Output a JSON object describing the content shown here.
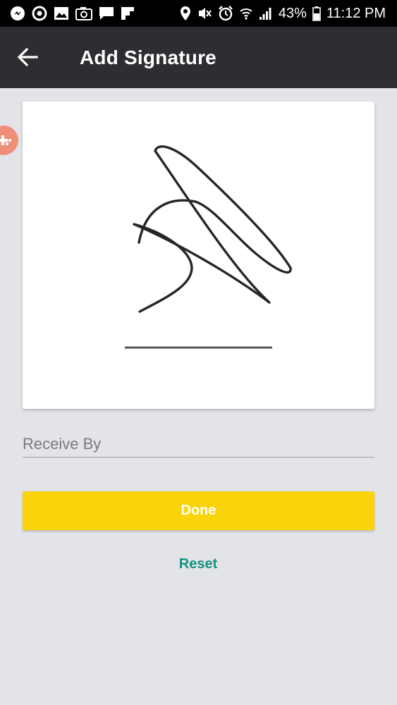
{
  "status_bar": {
    "battery": "43%",
    "time": "11:12 PM",
    "left_icons": [
      "messenger-icon",
      "sync-icon",
      "gallery-icon",
      "camera-icon",
      "message-icon",
      "flipboard-icon"
    ],
    "right_icons": [
      "location-icon",
      "vibrate-mute-icon",
      "alarm-icon",
      "wifi-icon",
      "signal-icon",
      "battery-icon"
    ]
  },
  "header": {
    "title": "Add Signature",
    "back_icon": "arrow-left-icon"
  },
  "signature": {
    "baseline_present": true
  },
  "form": {
    "receive_by_placeholder": "Receive By",
    "receive_by_value": ""
  },
  "actions": {
    "done_label": "Done",
    "reset_label": "Reset"
  },
  "colors": {
    "status_bar": "#000000",
    "app_bar": "#2e2d31",
    "background": "#e3e4e8",
    "done_button": "#fad40b",
    "reset_text": "#15927f",
    "floating_bubble": "#ef8f7a"
  }
}
